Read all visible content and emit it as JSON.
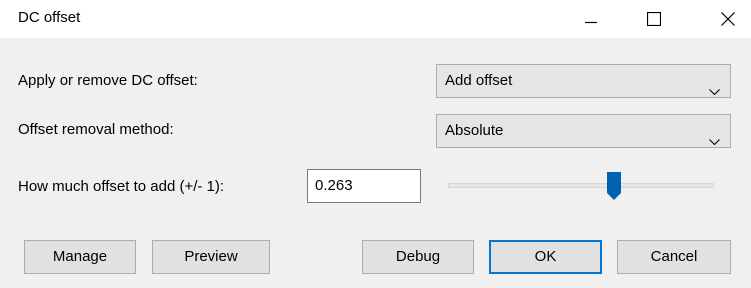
{
  "window": {
    "title": "DC offset"
  },
  "titlebar_buttons": {
    "minimize_icon": "minimize-icon",
    "maximize_icon": "maximize-icon",
    "close_icon": "close-icon"
  },
  "form": {
    "apply_label": "Apply or remove DC offset:",
    "apply_value": "Add offset",
    "method_label": "Offset removal method:",
    "method_value": "Absolute",
    "amount_label": "How much offset to add (+/- 1):",
    "amount_value": "0.263",
    "slider_fraction": 0.63
  },
  "buttons": {
    "manage": "Manage",
    "preview": "Preview",
    "debug": "Debug",
    "ok": "OK",
    "cancel": "Cancel"
  },
  "colors": {
    "accent": "#0078d7",
    "slider_thumb": "#0063b1"
  }
}
